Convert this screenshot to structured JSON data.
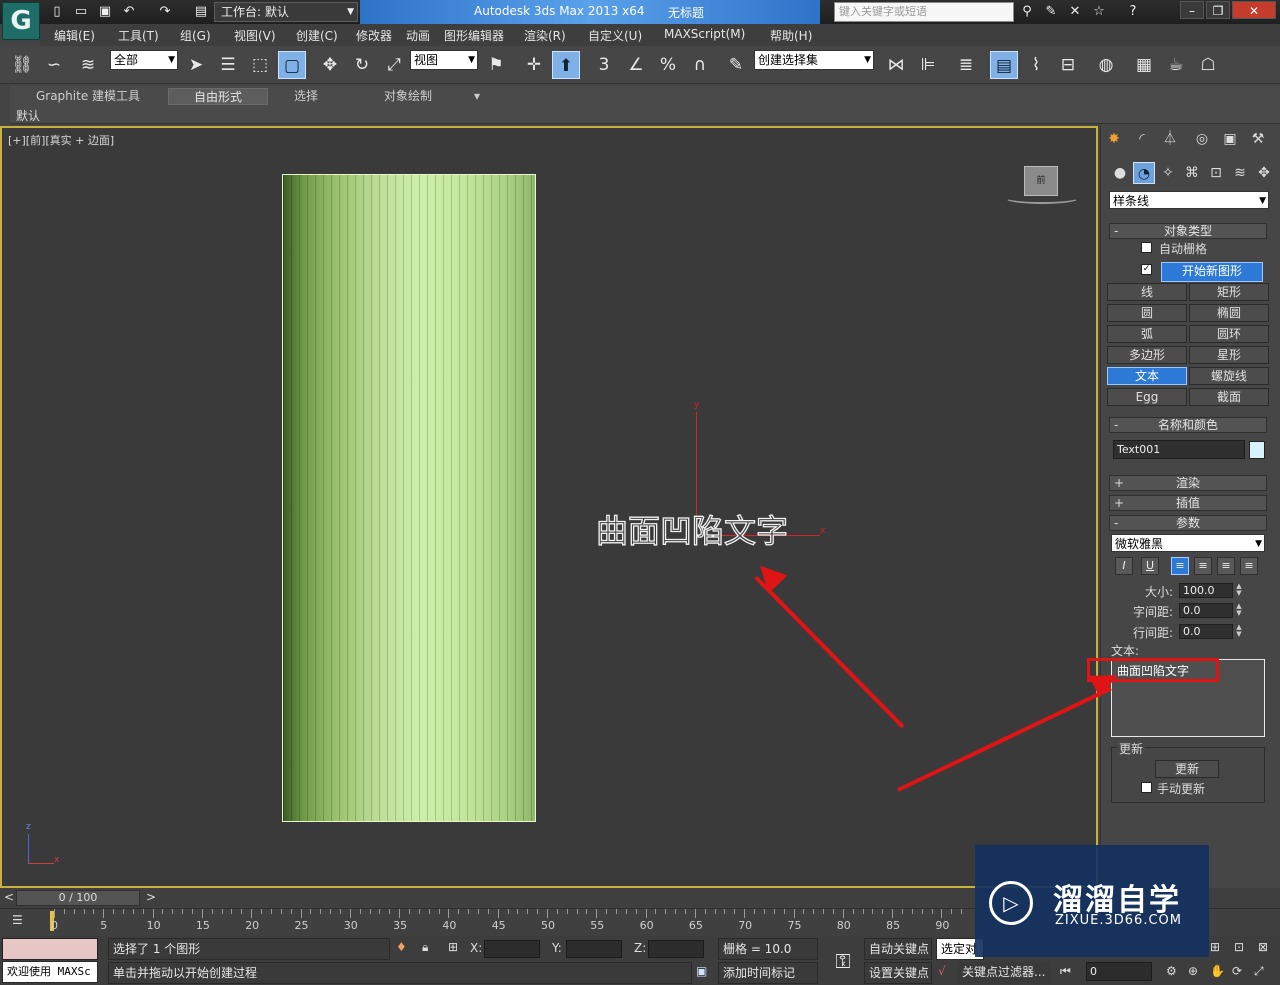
{
  "titlebar": {
    "workspace_label": "工作台: 默认",
    "app_title": "Autodesk 3ds Max  2013 x64",
    "doc_title": "无标题",
    "search_placeholder": "键入关键字或短语"
  },
  "menu": [
    "编辑(E)",
    "工具(T)",
    "组(G)",
    "视图(V)",
    "创建(C)",
    "修改器",
    "动画",
    "图形编辑器",
    "渲染(R)",
    "自定义(U)",
    "MAXScript(M)",
    "帮助(H)"
  ],
  "toolbar": {
    "filter_value": "全部",
    "refcoord_value": "视图",
    "selection_set_value": "创建选择集",
    "snap_label": "3"
  },
  "ribbon": {
    "tabs": [
      "Graphite 建模工具",
      "自由形式",
      "选择",
      "对象绘制"
    ],
    "active_tab": "自由形式",
    "sub_label": "默认"
  },
  "viewport": {
    "label": "[+][前][真实 + 边面]",
    "cube_label": "前",
    "text_object": "曲面凹陷文字",
    "x_axis": "x",
    "y_axis": "y",
    "gizmo_z": "z",
    "gizmo_x": "x"
  },
  "command_panel": {
    "category_value": "样条线",
    "object_type_title": "对象类型",
    "autogrid_label": "自动栅格",
    "start_new_shape_label": "开始新图形",
    "object_buttons": [
      "线",
      "矩形",
      "圆",
      "椭圆",
      "弧",
      "圆环",
      "多边形",
      "星形",
      "文本",
      "螺旋线",
      "Egg",
      "截面"
    ],
    "selected_object": "文本",
    "name_color_title": "名称和颜色",
    "object_name": "Text001",
    "swatch_color": "#d8f2ff",
    "rollouts_collapsed": [
      "渲染",
      "插值"
    ],
    "params_title": "参数",
    "font_value": "微软雅黑",
    "italic_label": "I",
    "underline_label": "U",
    "size_label": "大小:",
    "size_value": "100.0",
    "kerning_label": "字间距:",
    "kerning_value": "0.0",
    "leading_label": "行间距:",
    "leading_value": "0.0",
    "text_label": "文本:",
    "text_value": "曲面凹陷文字",
    "update_group": "更新",
    "update_button": "更新",
    "manual_update_label": "手动更新"
  },
  "timeline": {
    "slider_value": "0 / 100",
    "ticks": [
      "0",
      "5",
      "10",
      "15",
      "20",
      "25",
      "30",
      "35",
      "40",
      "45",
      "50",
      "55",
      "60",
      "65",
      "70",
      "75",
      "80",
      "85",
      "90"
    ]
  },
  "status": {
    "welcome": "欢迎使用 MAXSc",
    "selection_info": "选择了 1 个图形",
    "prompt": "单击并拖动以开始创建过程",
    "x_label": "X:",
    "y_label": "Y:",
    "z_label": "Z:",
    "grid": "栅格 = 10.0",
    "add_time_tag": "添加时间标记",
    "auto_key": "自动关键点",
    "selected_dropdown": "选定对",
    "set_key": "设置关键点",
    "key_filters": "关键点过滤器...",
    "frame_value": "0"
  },
  "watermark": {
    "title": "溜溜自学",
    "subtitle": "ZIXUE.3D66.COM"
  },
  "colors": {
    "accent": "#2d7ad6",
    "arrow": "#e01414",
    "viewport_border": "#c9b13e",
    "object_green": "#bfe19a"
  }
}
